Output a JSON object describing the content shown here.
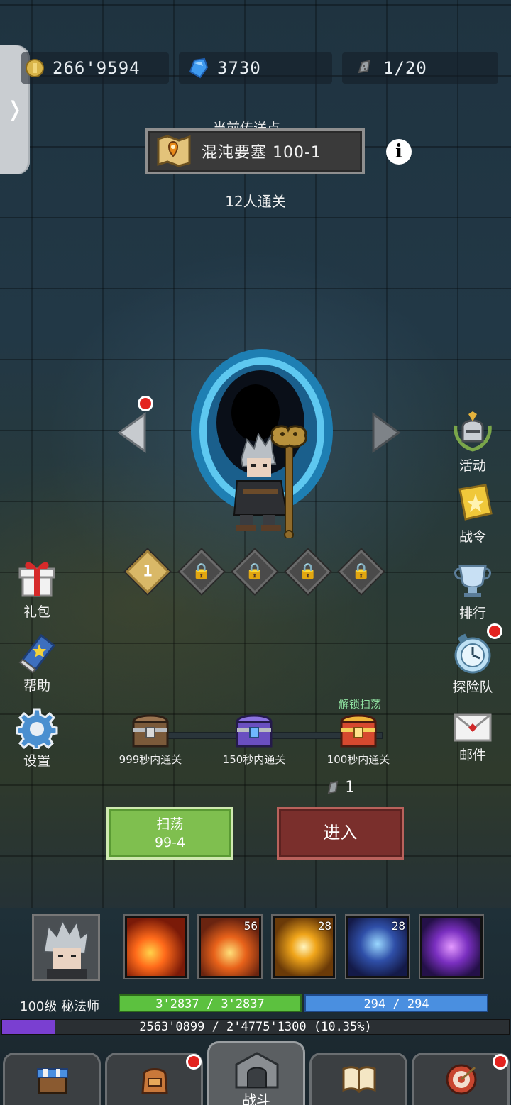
{
  "resources": {
    "gold": "266'9594",
    "gems": "3730",
    "stamina": "1/20"
  },
  "portal": {
    "label": "当前传送点",
    "name": "混沌要塞  100-1",
    "cleared_count": "12人通关"
  },
  "right_menu": {
    "events": "活动",
    "battle_pass": "战令",
    "ranking": "排行",
    "expedition": "探险队",
    "mail": "邮件"
  },
  "left_menu": {
    "gift": "礼包",
    "help": "帮助",
    "settings": "设置"
  },
  "stage_slots": {
    "current": "1"
  },
  "chests": {
    "unlock_sweep_label": "解锁扫荡",
    "items": [
      {
        "label": "999秒内通关"
      },
      {
        "label": "150秒内通关"
      },
      {
        "label": "100秒内通关"
      }
    ]
  },
  "entry_cost": "1",
  "buttons": {
    "sweep_title": "扫荡",
    "sweep_stage": "99-4",
    "enter": "进入"
  },
  "skills": [
    {
      "name": "fireball",
      "level": ""
    },
    {
      "name": "meteor",
      "level": "56"
    },
    {
      "name": "holy-light",
      "level": "28"
    },
    {
      "name": "star-staff",
      "level": "28"
    },
    {
      "name": "arcane-dash",
      "level": ""
    }
  ],
  "character": {
    "level_class": "100级 秘法师",
    "hp_text": "3'2837 / 3'2837",
    "mp_text": "294 / 294",
    "exp_text": "2563'0899 / 2'4775'1300 (10.35%)",
    "exp_progress": 0.1035
  },
  "bottom_nav": {
    "battle": "战斗"
  },
  "colors": {
    "hp_bar": "#5cc13f",
    "mp_bar": "#4a8fe0",
    "exp_bar": "#7a3fd1",
    "notification": "#e3231f"
  }
}
